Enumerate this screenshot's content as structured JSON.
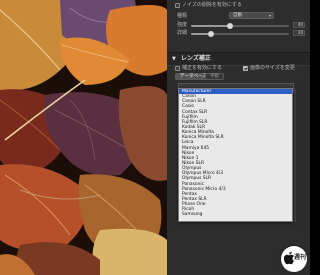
{
  "colors": {
    "panel_bg": "#2d2d2d",
    "dropdown_bg": "#e9e9e9",
    "selected_bg": "#2f5fc4"
  },
  "top_section": {
    "noise_reduction_checkbox": {
      "checked": false,
      "label": "ノイズの削除を有効にする"
    },
    "type_label": "種類",
    "type_value": "自動",
    "strength_label": "強度",
    "strength_value": "40",
    "strength_level": 0.4,
    "detail_label": "詳細",
    "detail_value": "20",
    "detail_level": 0.2
  },
  "lens_section": {
    "title": "レンズ補正",
    "enable_checkbox": {
      "checked": false,
      "label": "補正を有効にする"
    },
    "auto_size_checkbox": {
      "checked": true,
      "label": "画像のサイズを変更"
    },
    "tabs": [
      {
        "label": "データベース",
        "active": true
      },
      {
        "label": "手動",
        "active": false
      }
    ]
  },
  "dropdown": {
    "options": [
      "Manufacturer",
      "Canon",
      "Canon SLR",
      "Casio",
      "Contax SLR",
      "Fujifilm",
      "Fujifilm SLR",
      "Kodak SLR",
      "Konica Minolta",
      "Konica Minolta SLR",
      "Leica",
      "Mamiya 645",
      "Nikon",
      "Nikon 1",
      "Nikon SLR",
      "Olympus",
      "Olympus Micro 4/3",
      "Olympus SLR",
      "Panasonic",
      "Panasonic Micro 4/3",
      "Pentax",
      "Pentax SLR",
      "Phase One",
      "Ricoh",
      "Samsung"
    ],
    "selected_index": 0
  },
  "watermark": {
    "text": "週刊"
  }
}
